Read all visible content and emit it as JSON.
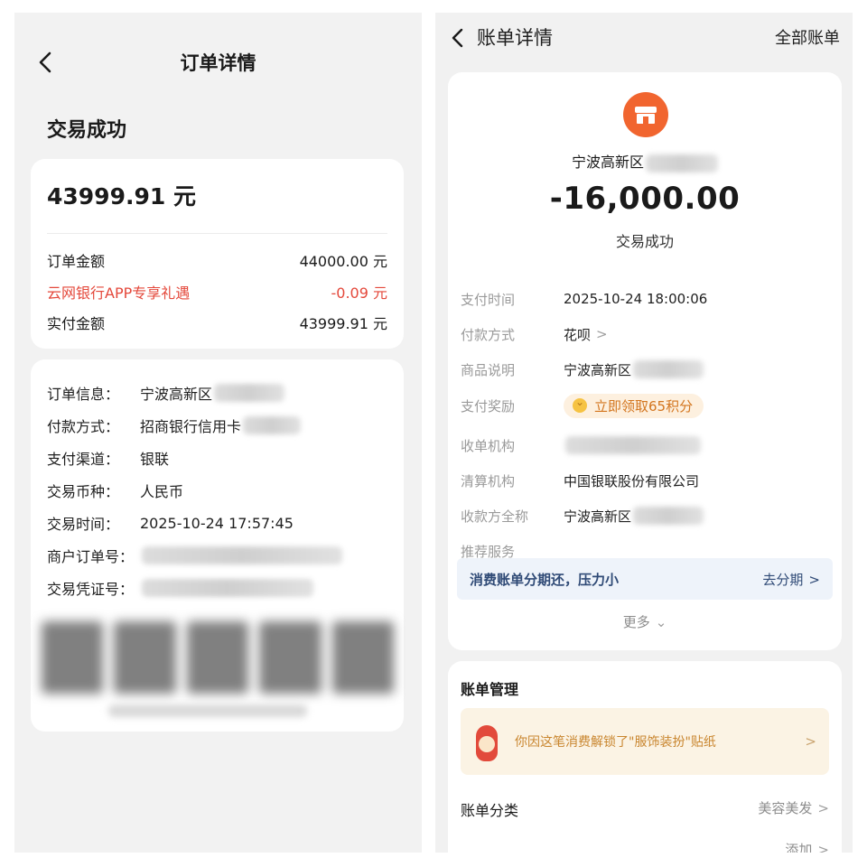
{
  "left": {
    "title": "订单详情",
    "status": "交易成功",
    "summary": {
      "total": "43999.91 元",
      "rows": [
        {
          "label": "订单金额",
          "value": "44000.00 元"
        },
        {
          "label": "云网银行APP专享礼遇",
          "value": "-0.09 元"
        },
        {
          "label": "实付金额",
          "value": "43999.91 元"
        }
      ]
    },
    "info": [
      {
        "label": "订单信息：",
        "value": "宁波高新区"
      },
      {
        "label": "付款方式：",
        "value": "招商银行信用卡"
      },
      {
        "label": "支付渠道：",
        "value": "银联"
      },
      {
        "label": "交易币种：",
        "value": "人民币"
      },
      {
        "label": "交易时间：",
        "value": "2025-10-24 17:57:45"
      },
      {
        "label": "商户订单号：",
        "value": ""
      },
      {
        "label": "交易凭证号：",
        "value": ""
      }
    ]
  },
  "right": {
    "title": "账单详情",
    "all_bills": "全部账单",
    "merchant": "宁波高新区",
    "amount": "-16,000.00",
    "status": "交易成功",
    "details": [
      {
        "label": "支付时间",
        "value": "2025-10-24 18:00:06"
      },
      {
        "label": "付款方式",
        "value": "花呗"
      },
      {
        "label": "商品说明",
        "value": "宁波高新区"
      },
      {
        "label": "支付奖励",
        "value": "立即领取65积分"
      },
      {
        "label": "收单机构",
        "value": ""
      },
      {
        "label": "清算机构",
        "value": "中国银联股份有限公司"
      },
      {
        "label": "收款方全称",
        "value": "宁波高新区"
      },
      {
        "label": "推荐服务",
        "value": ""
      }
    ],
    "promo": {
      "text": "消费账单分期还，压力小",
      "action": "去分期"
    },
    "more": "更多",
    "management": {
      "title": "账单管理",
      "sticker_text": "你因这笔消费解锁了\"服饰装扮\"贴纸",
      "category_label": "账单分类",
      "category_value": "美容美发",
      "add_label": "添加"
    }
  },
  "colors": {
    "accent_red": "#e4483b",
    "merchant_orange": "#f1652f",
    "reward_orange": "#d3751e",
    "promo_blue": "#2f4a76"
  }
}
